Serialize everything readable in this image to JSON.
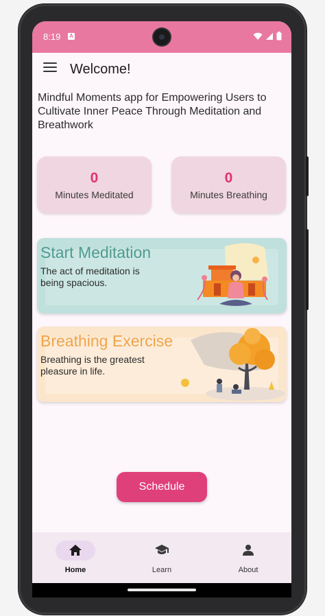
{
  "status_bar": {
    "time": "8:19",
    "notification": "A"
  },
  "app_bar": {
    "title": "Welcome!"
  },
  "intro_text": "Mindful Moments app for Empowering Users to Cultivate Inner Peace Through Meditation and Breathwork",
  "stats": [
    {
      "value": "0",
      "label": "Minutes Meditated"
    },
    {
      "value": "0",
      "label": "Minutes Breathing"
    }
  ],
  "cards": {
    "meditation": {
      "title": "Start Meditation",
      "description": "The act of meditation is being spacious."
    },
    "breathing": {
      "title": "Breathing Exercise",
      "description": "Breathing is the greatest pleasure in life."
    }
  },
  "schedule_label": "Schedule",
  "nav": [
    {
      "label": "Home",
      "icon": "home-icon",
      "active": true
    },
    {
      "label": "Learn",
      "icon": "school-icon",
      "active": false
    },
    {
      "label": "About",
      "icon": "person-icon",
      "active": false
    }
  ],
  "colors": {
    "status_bar": "#e8789f",
    "accent": "#e0407a",
    "stat_value": "#e0326d",
    "meditation_title": "#4f9a92",
    "breathing_title": "#f0a44a"
  }
}
